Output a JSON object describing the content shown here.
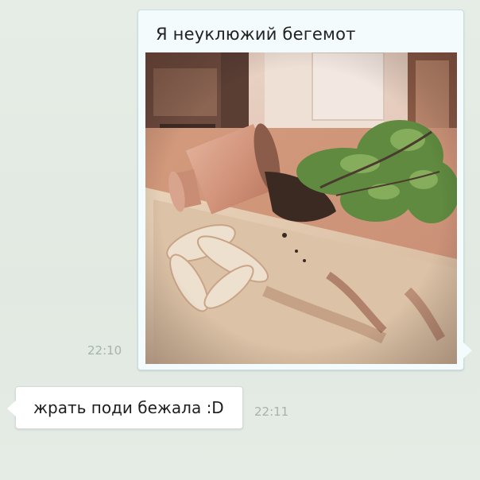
{
  "messages": [
    {
      "direction": "outgoing",
      "caption": "Я неуклюжий бегемот",
      "time": "22:10",
      "photo_icon": "photo-knocked-over-plant"
    },
    {
      "direction": "incoming",
      "text": "жрать поди бежала :D",
      "time": "22:11"
    }
  ],
  "colors": {
    "background": "#e3ebe4",
    "outgoing_bubble": "#f4fbfd",
    "incoming_bubble": "#ffffff",
    "timestamp": "#a7b3a8"
  }
}
